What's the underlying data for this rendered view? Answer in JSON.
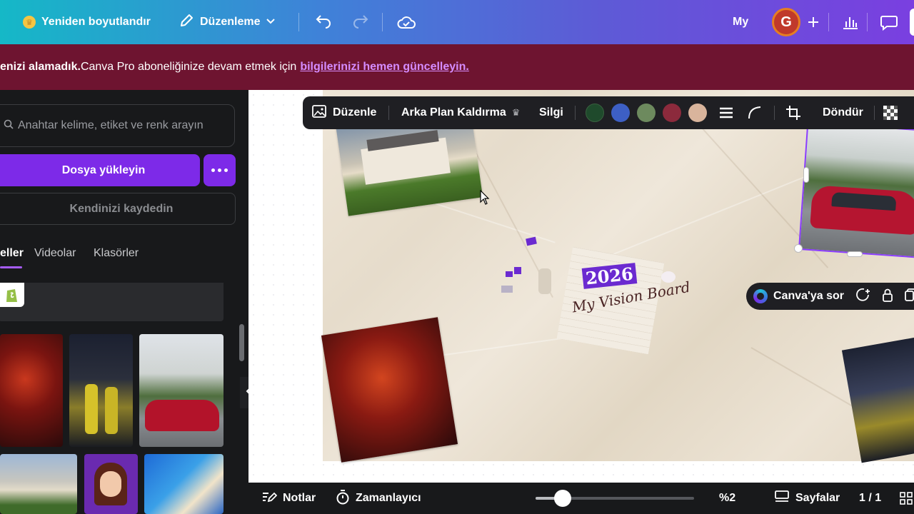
{
  "topbar": {
    "resize_label": "Yeniden boyutlandır",
    "edit_label": "Düzenleme",
    "username": "My",
    "avatar_initial": "G"
  },
  "banner": {
    "bold_text": "enizi alamadık.",
    "text": " Canva Pro aboneliğinize devam etmek için",
    "link_text": "bilgilerinizi hemen güncelleyin."
  },
  "sidebar": {
    "search_placeholder": "Anahtar kelime, etiket ve renk arayın",
    "upload_label": "Dosya yükleyin",
    "record_label": "Kendinizi kaydedin",
    "tabs": [
      {
        "label": "eller"
      },
      {
        "label": "Videolar"
      },
      {
        "label": "Klasörler"
      }
    ]
  },
  "toolbar": {
    "edit_label": "Düzenle",
    "bg_remove_label": "Arka Plan Kaldırma",
    "eraser_label": "Silgi",
    "rotate_label": "Döndür",
    "swatches": [
      "#1f4a2c",
      "#3d5fc4",
      "#6d8a5e",
      "#8c2a3c",
      "#d9b49c"
    ]
  },
  "canvas": {
    "ask_canva_label": "Canva'ya sor",
    "title_number": "2026",
    "title_script": "My Vision Board"
  },
  "footer": {
    "notes_label": "Notlar",
    "timer_label": "Zamanlayıcı",
    "zoom_label": "%2",
    "zoom_fraction": 0.17,
    "pages_label": "Sayfalar",
    "page_counter": "1 / 1"
  }
}
